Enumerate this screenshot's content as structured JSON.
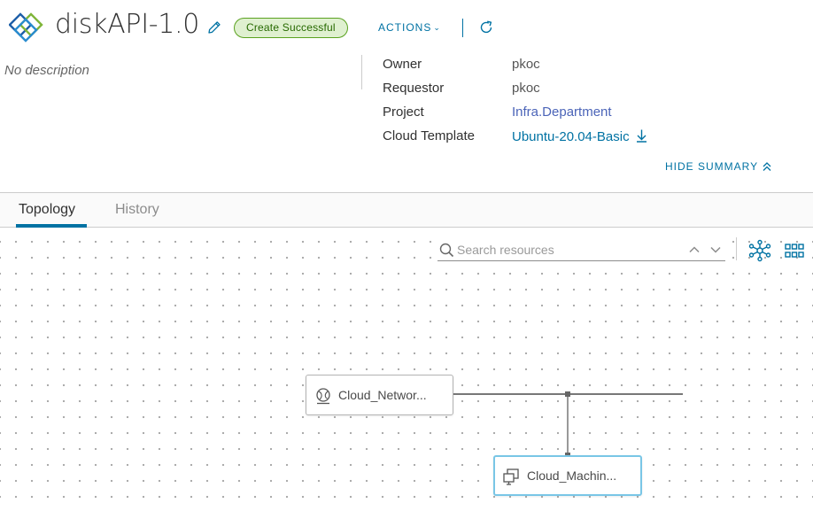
{
  "header": {
    "title": "diskAPI-1.0",
    "status": "Create Successful",
    "actions_label": "ACTIONS"
  },
  "summary": {
    "description": "No description",
    "fields": [
      {
        "label": "Owner",
        "value": "pkoc"
      },
      {
        "label": "Requestor",
        "value": "pkoc"
      },
      {
        "label": "Project",
        "value": "Infra.Department"
      },
      {
        "label": "Cloud Template",
        "value": "Ubuntu-20.04-Basic"
      }
    ],
    "hide_label": "HIDE SUMMARY"
  },
  "tabs": [
    {
      "label": "Topology",
      "active": true
    },
    {
      "label": "History",
      "active": false
    }
  ],
  "toolbar": {
    "search_placeholder": "Search resources"
  },
  "topology": {
    "nodes": [
      {
        "label": "Cloud_Networ...",
        "icon": "network-icon"
      },
      {
        "label": "Cloud_Machin...",
        "icon": "machine-icon",
        "selected": true
      }
    ]
  },
  "colors": {
    "accent": "#0072a3",
    "success_bg": "#dff0d0",
    "success_border": "#5aa220",
    "selected_border": "#79c6e6"
  }
}
